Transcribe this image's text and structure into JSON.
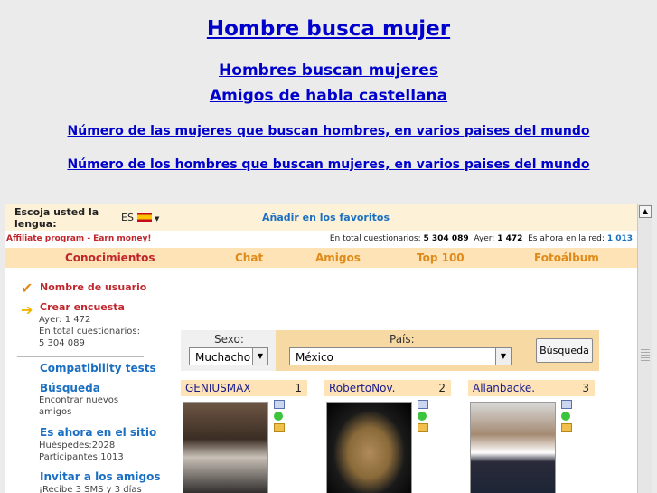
{
  "header": {
    "title": "Hombre busca mujer",
    "subtitle1": "Hombres buscan mujeres",
    "subtitle2": "Amigos de habla castellana",
    "link1": "Número de las mujeres que buscan hombres, en varios paises del mundo",
    "link2": "Número de los hombres que buscan mujeres, en varios paises del mundo"
  },
  "topbar": {
    "lang_label": "Escoja usted la lengua:",
    "lang_value": "ES",
    "favorites": "Añadir en los favoritos"
  },
  "infobar": {
    "affiliate": "Affiliate program - Earn money!",
    "total_label": "En total cuestionarios:",
    "total_value": "5 304 089",
    "yesterday_label": "Ayer:",
    "yesterday_value": "1 472",
    "online_label": "Es ahora en la red:",
    "online_value": "1 013"
  },
  "menu": {
    "items": [
      "Conocimientos",
      "Chat",
      "Amigos",
      "Top 100",
      "Fotoálbum"
    ]
  },
  "sidebar": {
    "username": "Nombre de usuario",
    "create": "Crear encuesta",
    "create_sub1": "Ayer: 1 472",
    "create_sub2": "En total cuestionarios:",
    "create_sub3": "5 304 089",
    "compat": "Compatibility tests",
    "search": "Búsqueda",
    "search_sub1": "Encontrar nuevos",
    "search_sub2": "amigos",
    "online": "Es ahora en el sitio",
    "online_sub1": "Huéspedes:2028",
    "online_sub2": "Participantes:1013",
    "invite": "Invitar a los amigos",
    "invite_sub": "¡Recibe 3 SMS y 3 días"
  },
  "search_form": {
    "sex_label": "Sexo:",
    "sex_value": "Muchacho",
    "country_label": "País:",
    "country_value": "México",
    "button": "Búsqueda"
  },
  "cards": [
    {
      "name": "GENIUSMAX",
      "num": "1"
    },
    {
      "name": "RobertoNov.",
      "num": "2"
    },
    {
      "name": "Allanbacke.",
      "num": "3"
    }
  ]
}
